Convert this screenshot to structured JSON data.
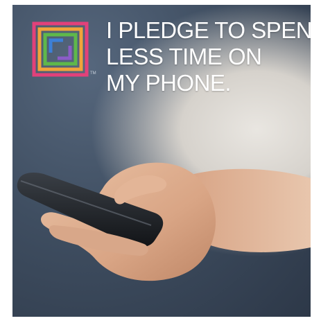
{
  "poster": {
    "headline_lines": [
      "I PLEDGE TO SPEND",
      "LESS TIME ON",
      "MY PHONE."
    ],
    "trademark": "TM",
    "logo_colors": [
      "#e2417a",
      "#f2a33a",
      "#5fb84a",
      "#3c7fd6",
      "#8b5cc7"
    ]
  }
}
